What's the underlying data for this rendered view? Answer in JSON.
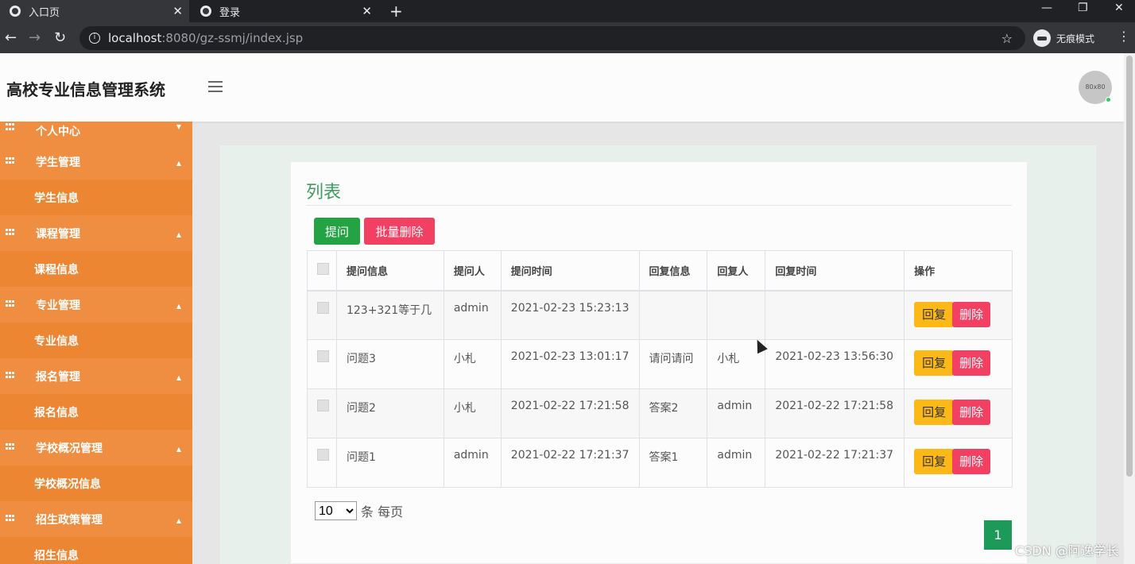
{
  "browser": {
    "tabs": [
      {
        "title": "入口页",
        "icon": "globe-icon",
        "active": true
      },
      {
        "title": "登录",
        "icon": "globe-icon",
        "active": false
      }
    ],
    "url_host": "localhost",
    "url_rest": ":8080/gz-ssmj/index.jsp",
    "incognito_label": "无痕模式"
  },
  "header": {
    "title": "高校专业信息管理系统",
    "avatar_text": "80x80"
  },
  "sidebar": {
    "items": [
      {
        "label": "个人中心",
        "sub": ""
      },
      {
        "label": "学生管理",
        "sub": "学生信息"
      },
      {
        "label": "课程管理",
        "sub": "课程信息"
      },
      {
        "label": "专业管理",
        "sub": "专业信息"
      },
      {
        "label": "报名管理",
        "sub": "报名信息"
      },
      {
        "label": "学校概况管理",
        "sub": "学校概况信息"
      },
      {
        "label": "招生政策管理",
        "sub": "招生信息"
      }
    ],
    "colors": {
      "bg": "#ed8633",
      "group_bg": "#ef8d40"
    }
  },
  "main": {
    "title": "列表",
    "ask_button": "提问",
    "batch_delete_button": "批量删除",
    "columns": [
      "提问信息",
      "提问人",
      "提问时间",
      "回复信息",
      "回复人",
      "回复时间",
      "操作"
    ],
    "rows": [
      {
        "question": "123+321等于几",
        "asker": "admin",
        "ask_time": "2021-02-23 15:23:13",
        "reply": "",
        "replier": "",
        "reply_time": ""
      },
      {
        "question": "问题3",
        "asker": "小札",
        "ask_time": "2021-02-23 13:01:17",
        "reply": "请问请问",
        "replier": "小札",
        "reply_time": "2021-02-23 13:56:30"
      },
      {
        "question": "问题2",
        "asker": "小札",
        "ask_time": "2021-02-22 17:21:58",
        "reply": "答案2",
        "replier": "admin",
        "reply_time": "2021-02-22 17:21:58"
      },
      {
        "question": "问题1",
        "asker": "admin",
        "ask_time": "2021-02-22 17:21:37",
        "reply": "答案1",
        "replier": "admin",
        "reply_time": "2021-02-22 17:21:37"
      }
    ],
    "reply_button": "回复",
    "delete_button": "删除",
    "page_size": "10",
    "page_size_suffix": "条 每页",
    "current_page": "1"
  },
  "watermark": "CSDN @阿逸学长"
}
